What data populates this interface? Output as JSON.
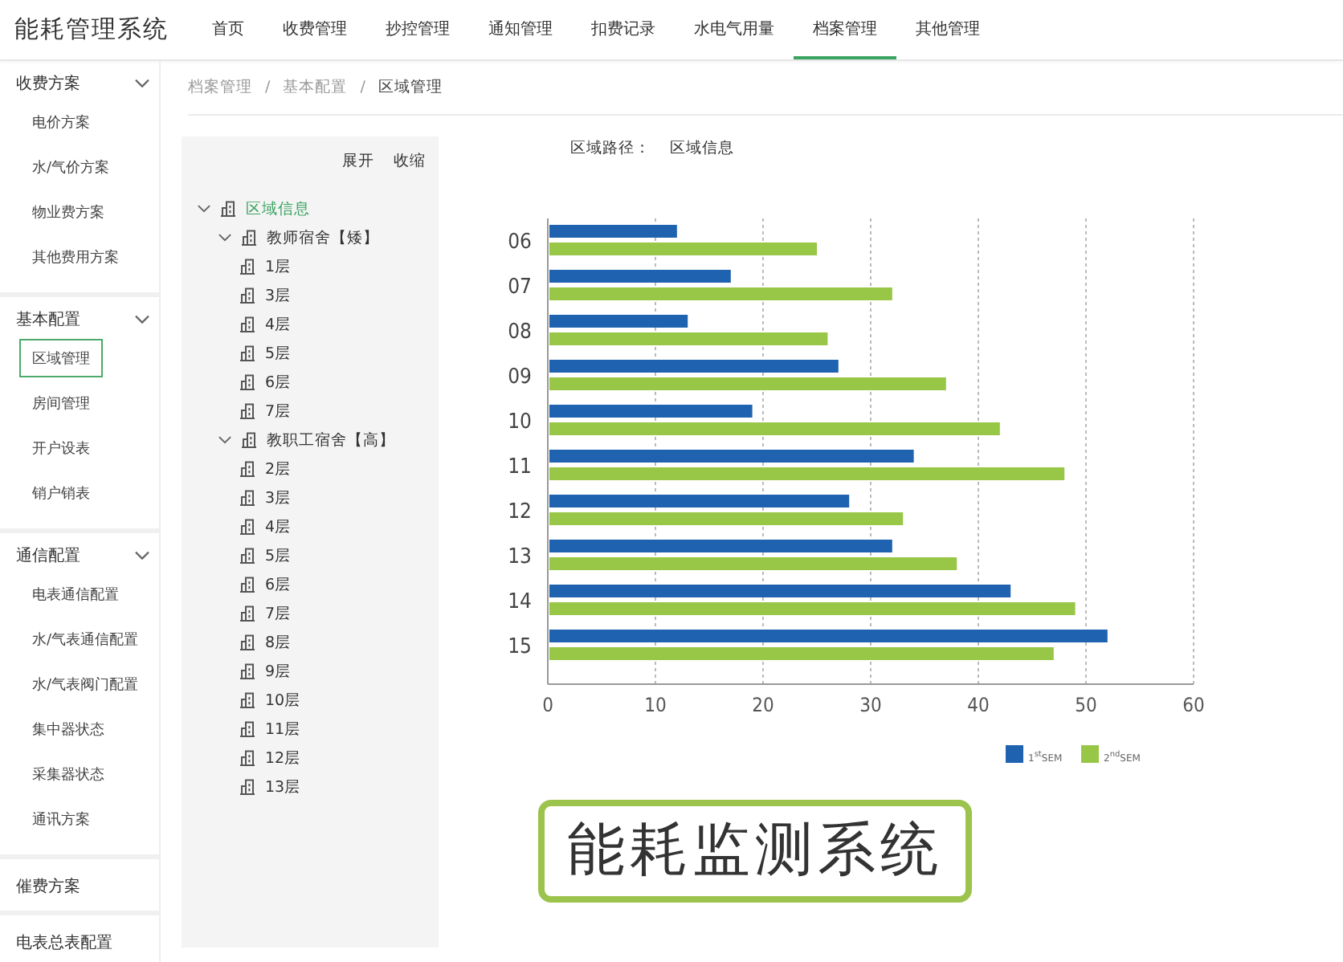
{
  "app": {
    "title": "能耗管理系统"
  },
  "nav": {
    "tabs": [
      {
        "label": "首页",
        "selected": false
      },
      {
        "label": "收费管理",
        "selected": false
      },
      {
        "label": "抄控管理",
        "selected": false
      },
      {
        "label": "通知管理",
        "selected": false
      },
      {
        "label": "扣费记录",
        "selected": false
      },
      {
        "label": "水电气用量",
        "selected": false
      },
      {
        "label": "档案管理",
        "selected": true
      },
      {
        "label": "其他管理",
        "selected": false
      }
    ]
  },
  "sidebar": {
    "groups": [
      {
        "label": "收费方案",
        "kind": "group",
        "expanded": true,
        "items": [
          {
            "label": "电价方案",
            "selected": false
          },
          {
            "label": "水/气价方案",
            "selected": false
          },
          {
            "label": "物业费方案",
            "selected": false
          },
          {
            "label": "其他费用方案",
            "selected": false
          }
        ]
      },
      {
        "label": "基本配置",
        "kind": "group",
        "expanded": true,
        "items": [
          {
            "label": "区域管理",
            "selected": true
          },
          {
            "label": "房间管理",
            "selected": false
          },
          {
            "label": "开户设表",
            "selected": false
          },
          {
            "label": "销户销表",
            "selected": false
          }
        ]
      },
      {
        "label": "通信配置",
        "kind": "group",
        "expanded": true,
        "items": [
          {
            "label": "电表通信配置",
            "selected": false
          },
          {
            "label": "水/气表通信配置",
            "selected": false
          },
          {
            "label": "水/气表阀门配置",
            "selected": false
          },
          {
            "label": "集中器状态",
            "selected": false
          },
          {
            "label": "采集器状态",
            "selected": false
          },
          {
            "label": "通讯方案",
            "selected": false
          }
        ]
      },
      {
        "label": "催费方案",
        "kind": "link"
      },
      {
        "label": "电表总表配置",
        "kind": "link"
      }
    ]
  },
  "breadcrumb": {
    "items": [
      "档案管理",
      "基本配置",
      "区域管理"
    ],
    "separators": [
      "/",
      "/"
    ]
  },
  "tree": {
    "actions": [
      "展开",
      "收缩"
    ],
    "nodes": [
      {
        "label": "区域信息",
        "selected": true,
        "expanded": true,
        "children": [
          {
            "label": "教师宿舍【矮】",
            "selected": false,
            "expanded": true,
            "children": [
              {
                "label": "1层",
                "selected": false
              },
              {
                "label": "3层",
                "selected": false
              },
              {
                "label": "4层",
                "selected": false
              },
              {
                "label": "5层",
                "selected": false
              },
              {
                "label": "6层",
                "selected": false
              },
              {
                "label": "7层",
                "selected": false
              }
            ]
          },
          {
            "label": "教职工宿舍【高】",
            "selected": false,
            "expanded": true,
            "children": [
              {
                "label": "2层",
                "selected": false
              },
              {
                "label": "3层",
                "selected": false
              },
              {
                "label": "4层",
                "selected": false
              },
              {
                "label": "5层",
                "selected": false
              },
              {
                "label": "6层",
                "selected": false
              },
              {
                "label": "7层",
                "selected": false
              },
              {
                "label": "8层",
                "selected": false
              },
              {
                "label": "9层",
                "selected": false
              },
              {
                "label": "10层",
                "selected": false
              },
              {
                "label": "11层",
                "selected": false
              },
              {
                "label": "12层",
                "selected": false
              },
              {
                "label": "13层",
                "selected": false
              }
            ]
          }
        ]
      }
    ]
  },
  "detail": {
    "path_label": "区域路径：",
    "path_value": "区域信息",
    "chart_data": {
      "type": "bar",
      "orientation": "horizontal",
      "categories": [
        "06",
        "07",
        "08",
        "09",
        "10",
        "11",
        "12",
        "13",
        "14",
        "15"
      ],
      "series": [
        {
          "name": "1$^{st}$SEM",
          "color": "#1f63b0",
          "values": [
            12,
            17,
            13,
            27,
            19,
            34,
            28,
            32,
            43,
            52
          ]
        },
        {
          "name": "2$^{nd}$SEM",
          "color": "#98c646",
          "values": [
            25,
            32,
            26,
            37,
            42,
            48,
            33,
            38,
            49,
            47
          ]
        }
      ],
      "xlim": [
        0,
        60
      ],
      "xticks": [
        0,
        10,
        20,
        30,
        40,
        50,
        60
      ],
      "grid": true,
      "legend": true
    }
  },
  "caption": "能耗监测系统"
}
